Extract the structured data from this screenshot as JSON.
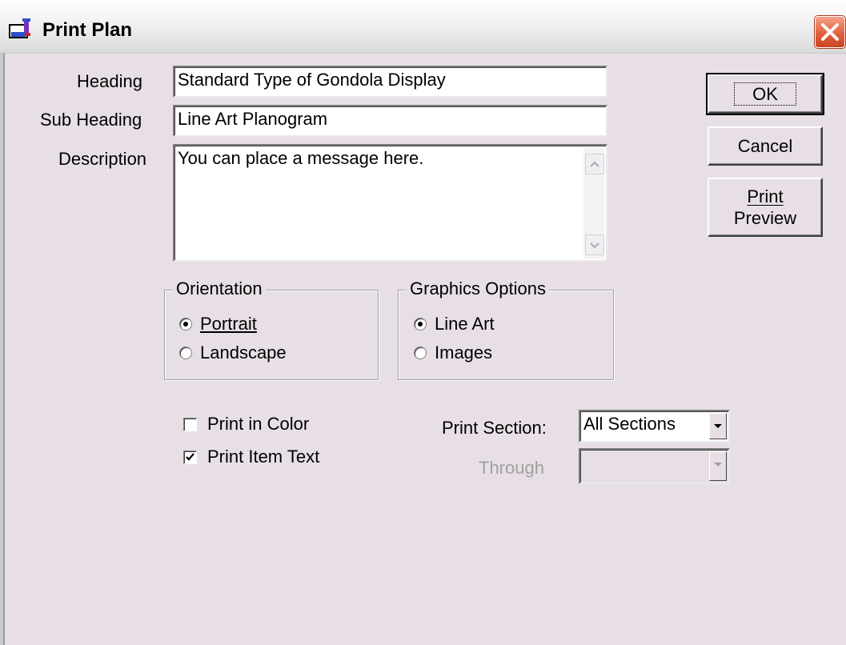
{
  "window": {
    "title": "Print Plan",
    "icon": "print-plan-icon",
    "close_icon": "close-icon"
  },
  "form": {
    "heading_label": "Heading",
    "heading_value": "Standard Type of Gondola Display",
    "subheading_label": "Sub Heading",
    "subheading_value": "Line Art Planogram",
    "description_label": "Description",
    "description_value": "You can place a message here."
  },
  "buttons": {
    "ok": "OK",
    "cancel": "Cancel",
    "print_preview_line1": "Print",
    "print_preview_line2": "Preview"
  },
  "orientation": {
    "legend": "Orientation",
    "options": [
      {
        "label": "Portrait",
        "selected": true
      },
      {
        "label": "Landscape",
        "selected": false
      }
    ]
  },
  "graphics": {
    "legend": "Graphics Options",
    "options": [
      {
        "label": "Line Art",
        "selected": true
      },
      {
        "label": "Images",
        "selected": false
      }
    ]
  },
  "checkboxes": [
    {
      "label": "Print in Color",
      "checked": false
    },
    {
      "label": "Print Item Text",
      "checked": true
    }
  ],
  "sections": {
    "print_section_label": "Print Section:",
    "print_section_value": "All Sections",
    "through_label": "Through",
    "through_value": ""
  },
  "colors": {
    "dialog_bg": "#e8dfe6",
    "close_button": "#e2623f"
  }
}
